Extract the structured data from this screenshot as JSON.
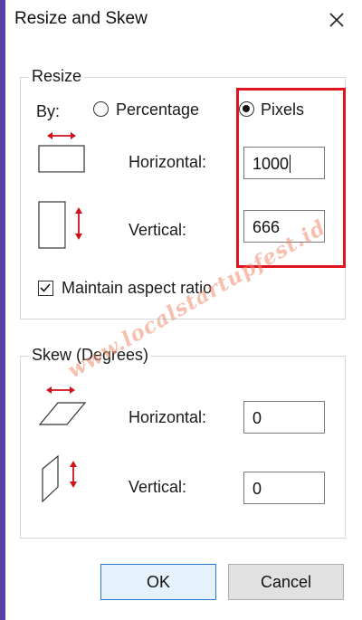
{
  "window": {
    "title": "Resize and Skew"
  },
  "resize": {
    "group_label": "Resize",
    "by_label": "By:",
    "percentage_label": "Percentage",
    "pixels_label": "Pixels",
    "selected": "Pixels",
    "horizontal_label": "Horizontal:",
    "horizontal_value": "1000",
    "vertical_label": "Vertical:",
    "vertical_value": "666",
    "maintain_aspect_label": "Maintain aspect ratio",
    "maintain_aspect_checked": true
  },
  "skew": {
    "group_label": "Skew (Degrees)",
    "horizontal_label": "Horizontal:",
    "horizontal_value": "0",
    "vertical_label": "Vertical:",
    "vertical_value": "0"
  },
  "buttons": {
    "ok_label": "OK",
    "cancel_label": "Cancel"
  },
  "watermark": "www.localstartupfest.id",
  "colors": {
    "arrow": "#d0111b",
    "highlight": "#e0141e",
    "ok_border": "#2b7bd1",
    "window_accent": "#5b3fa6"
  },
  "icons": {
    "close": "close-icon",
    "resize_horizontal": "resize-horizontal-icon",
    "resize_vertical": "resize-vertical-icon",
    "skew_horizontal": "skew-horizontal-icon",
    "skew_vertical": "skew-vertical-icon",
    "checkmark": "checkmark-icon"
  }
}
